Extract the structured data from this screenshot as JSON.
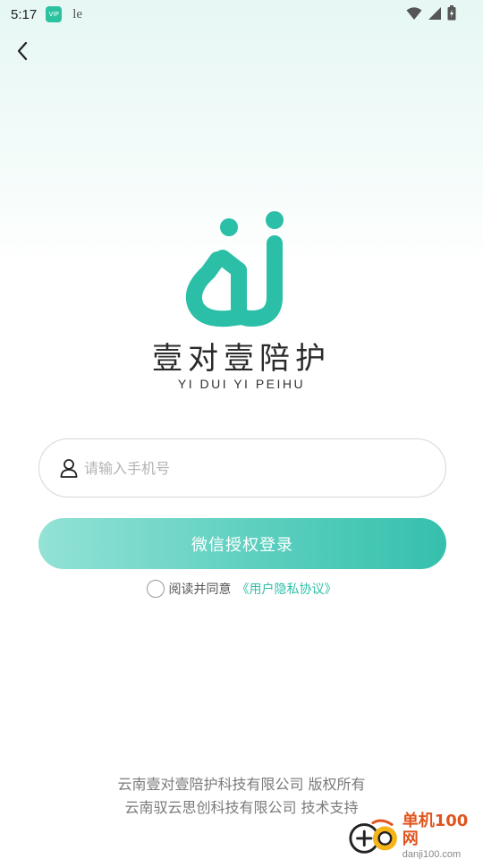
{
  "status_bar": {
    "time": "5:17",
    "app_badge": "VIP",
    "le_icon": "le"
  },
  "colors": {
    "accent": "#35c0ac",
    "accent_light": "#93e2d6",
    "logo": "#2bbfa8"
  },
  "icons": {
    "back": "chevron-left-icon",
    "user": "user-icon",
    "wifi": "wifi-icon",
    "signal": "signal-icon",
    "battery": "battery-icon"
  },
  "brand": {
    "name_cn": "壹对壹陪护",
    "name_en": "YI DUI YI PEIHU"
  },
  "login": {
    "phone_placeholder": "请输入手机号",
    "phone_value": "",
    "wechat_button": "微信授权登录",
    "agree_text": "阅读并同意",
    "agreement_link": "《用户隐私协议》",
    "agreed": false
  },
  "footer": {
    "copyright": "云南壹对壹陪护科技有限公司 版权所有",
    "support": "云南驭云思创科技有限公司 技术支持"
  },
  "watermark": {
    "title": "单机100网",
    "url": "danji100.com"
  }
}
